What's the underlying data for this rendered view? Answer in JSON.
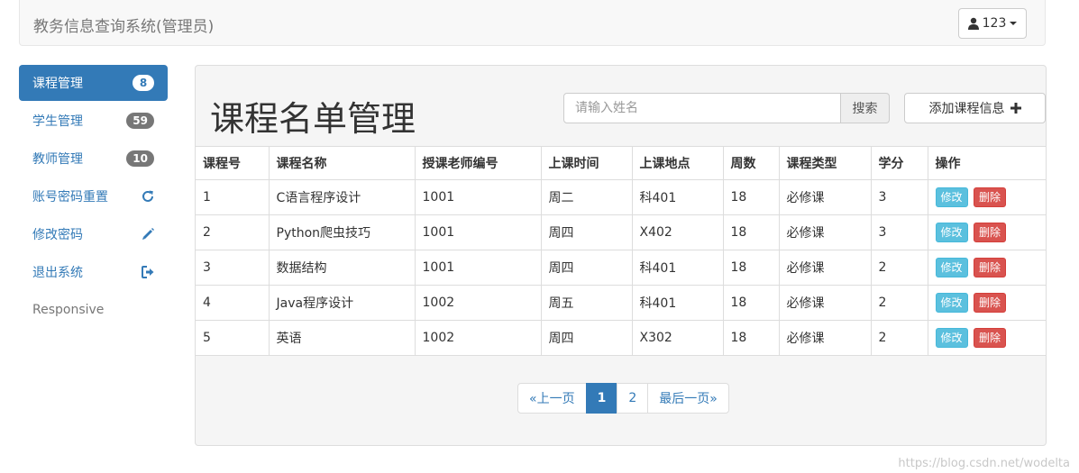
{
  "header": {
    "brand": "教务信息查询系统(管理员)",
    "user_label": "123"
  },
  "sidebar": {
    "items": [
      {
        "label": "课程管理",
        "badge": "8",
        "active": true
      },
      {
        "label": "学生管理",
        "badge": "59"
      },
      {
        "label": "教师管理",
        "badge": "10"
      },
      {
        "label": "账号密码重置",
        "icon": "refresh-icon"
      },
      {
        "label": "修改密码",
        "icon": "pencil-icon"
      },
      {
        "label": "退出系统",
        "icon": "logout-icon"
      },
      {
        "label": "Responsive"
      }
    ]
  },
  "main": {
    "title": "课程名单管理",
    "search": {
      "placeholder": "请输入姓名",
      "button": "搜索"
    },
    "add_button": "添加课程信息"
  },
  "table": {
    "headers": [
      "课程号",
      "课程名称",
      "授课老师编号",
      "上课时间",
      "上课地点",
      "周数",
      "课程类型",
      "学分",
      "操作"
    ],
    "rows": [
      [
        "1",
        "C语言程序设计",
        "1001",
        "周二",
        "科401",
        "18",
        "必修课",
        "3"
      ],
      [
        "2",
        "Python爬虫技巧",
        "1001",
        "周四",
        "X402",
        "18",
        "必修课",
        "3"
      ],
      [
        "3",
        "数据结构",
        "1001",
        "周四",
        "科401",
        "18",
        "必修课",
        "2"
      ],
      [
        "4",
        "Java程序设计",
        "1002",
        "周五",
        "科401",
        "18",
        "必修课",
        "2"
      ],
      [
        "5",
        "英语",
        "1002",
        "周四",
        "X302",
        "18",
        "必修课",
        "2"
      ]
    ],
    "edit_label": "修改",
    "delete_label": "删除"
  },
  "pagination": {
    "prev": "«上一页",
    "pages": [
      "1",
      "2"
    ],
    "current": "1",
    "last": "最后一页»"
  },
  "watermark": "https://blog.csdn.net/wodelta",
  "colors": {
    "primary": "#337ab7",
    "info": "#5bc0de",
    "danger": "#d9534f",
    "badge": "#777777"
  }
}
